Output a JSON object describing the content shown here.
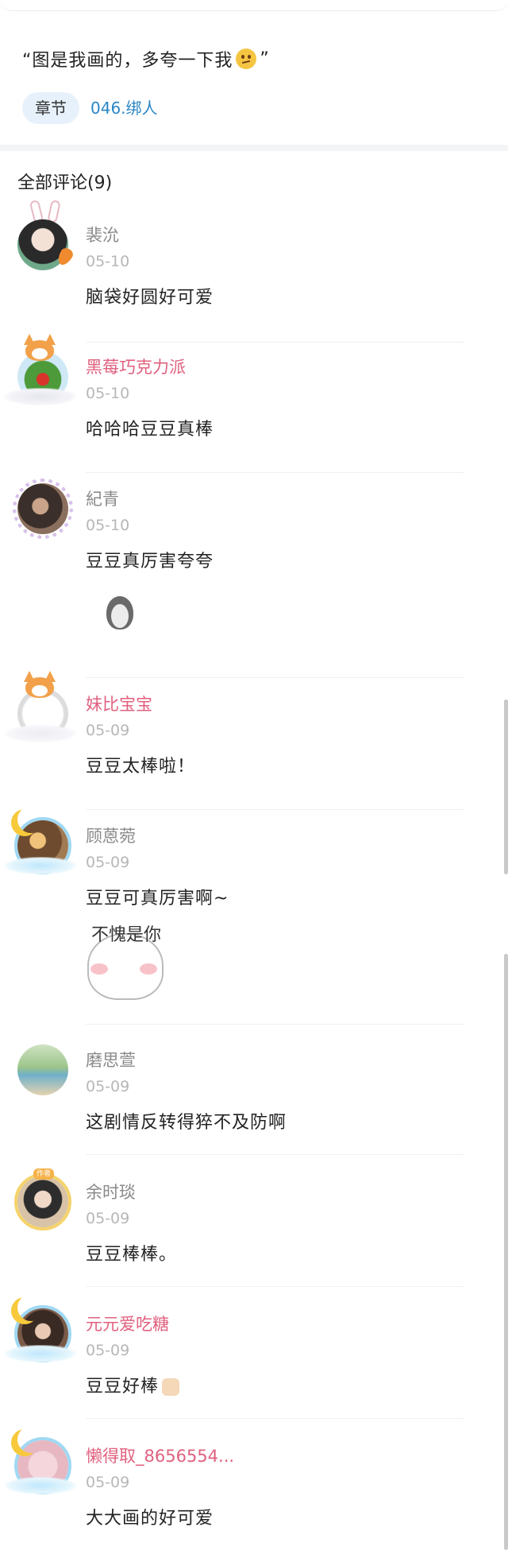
{
  "post": {
    "quote_text": "“图是我画的，多夸一下我",
    "quote_end": "”",
    "chapter_label": "章节",
    "chapter_link": "046.绑人"
  },
  "comments_header": "全部评论(9)",
  "colors": {
    "vip_name": "#e0607e",
    "link": "#2a86c5",
    "pill_bg": "#e6f1fb"
  },
  "comments": [
    {
      "name": "裴沇",
      "date": "05-10",
      "text": "脑袋好圆好可爱",
      "name_style": "normal",
      "avatar_deco": "bunny-ears-carrot"
    },
    {
      "name": "黑莓巧克力派",
      "date": "05-10",
      "text": "哈哈哈豆豆真棒",
      "name_style": "vip",
      "avatar_deco": "corgi"
    },
    {
      "name": "紀青",
      "date": "05-10",
      "text": "豆豆真厉害夸夸",
      "name_style": "normal",
      "avatar_deco": "lace-ring",
      "sticker": "penguin"
    },
    {
      "name": "妹比宝宝",
      "date": "05-09",
      "text": "豆豆太棒啦！",
      "name_style": "vip",
      "avatar_deco": "corgi"
    },
    {
      "name": "顾蒽菀",
      "date": "05-09",
      "text": "豆豆可真厉害啊~",
      "name_style": "normal",
      "avatar_deco": "moon-cloud",
      "sticker": "bun",
      "sticker_text": "不愧是你"
    },
    {
      "name": "磨思萱",
      "date": "05-09",
      "text": "这剧情反转得猝不及防啊",
      "name_style": "normal",
      "avatar_deco": "none"
    },
    {
      "name": "余时琰",
      "date": "05-09",
      "text": "豆豆棒棒。",
      "name_style": "normal",
      "avatar_deco": "badge-ring",
      "badge_text": "作者"
    },
    {
      "name": "元元爱吃糖",
      "date": "05-09",
      "text": "豆豆好棒",
      "name_style": "vip",
      "avatar_deco": "moon-cloud",
      "emoji": "thumbs-up-icon"
    },
    {
      "name": "懒得取_8656554...",
      "date": "05-09",
      "text": "大大画的好可爱",
      "name_style": "vip",
      "avatar_deco": "moon-cloud"
    }
  ]
}
